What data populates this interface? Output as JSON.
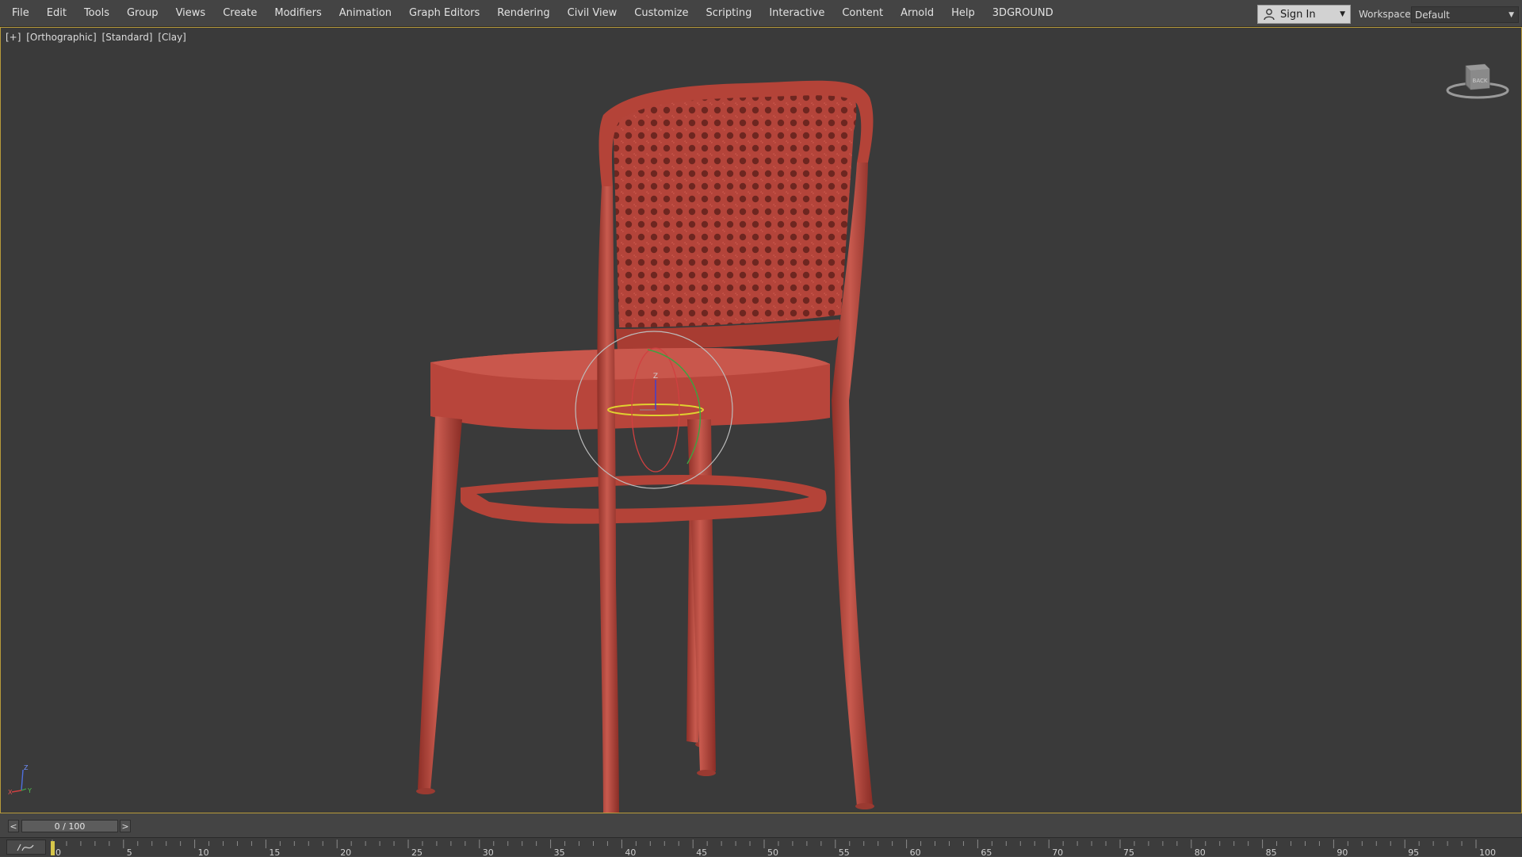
{
  "menu": {
    "items": [
      "File",
      "Edit",
      "Tools",
      "Group",
      "Views",
      "Create",
      "Modifiers",
      "Animation",
      "Graph Editors",
      "Rendering",
      "Civil View",
      "Customize",
      "Scripting",
      "Interactive",
      "Content",
      "Arnold",
      "Help",
      "3DGROUND"
    ]
  },
  "account": {
    "sign_in_label": "Sign In"
  },
  "workspaces": {
    "label": "Workspaces:",
    "value": "Default"
  },
  "viewport": {
    "labels": [
      "[+]",
      "[Orthographic]",
      "[Standard]",
      "[Clay]"
    ],
    "viewcube_text": "BACK",
    "gizmo_axis": "Z",
    "tripod_axes": [
      "Z",
      "X",
      "Y"
    ]
  },
  "timeline": {
    "prev_label": "<",
    "next_label": ">",
    "frame_display": "0 / 100",
    "current_frame": 0,
    "total_frames": 100,
    "tick_labels": [
      "0",
      "5",
      "10",
      "15",
      "20",
      "25",
      "30",
      "35",
      "40",
      "45",
      "50",
      "55",
      "60",
      "65",
      "70",
      "75",
      "80",
      "85",
      "90",
      "95",
      "100"
    ]
  },
  "colors": {
    "chair": "#b8453b",
    "viewport_bg": "#3a3a3a",
    "viewport_border": "#b79a3a",
    "gizmo_x": "#d04040",
    "gizmo_y": "#40a040",
    "gizmo_z": "#e0d030"
  }
}
